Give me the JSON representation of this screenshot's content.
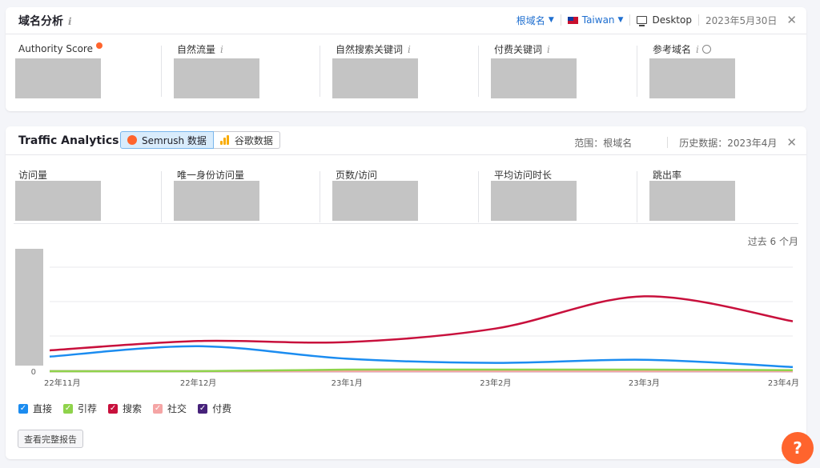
{
  "domain_panel": {
    "title": "域名分析",
    "scope": "根域名",
    "country": "Taiwan",
    "device": "Desktop",
    "date": "2023年5月30日",
    "metrics": [
      {
        "label": "Authority Score"
      },
      {
        "label": "自然流量"
      },
      {
        "label": "自然搜索关键词"
      },
      {
        "label": "付费关键词"
      },
      {
        "label": "参考域名"
      }
    ]
  },
  "traffic_panel": {
    "title": "Traffic Analytics",
    "source_semrush": "Semrush 数据",
    "source_google": "谷歌数据",
    "scope_text": "范围：根域名",
    "history_text": "历史数据：2023年4月",
    "metrics": [
      {
        "label": "访问量"
      },
      {
        "label": "唯一身份访问量"
      },
      {
        "label": "页数/访问"
      },
      {
        "label": "平均访问时长"
      },
      {
        "label": "跳出率"
      }
    ],
    "range_label": "过去 6 个月",
    "report_button": "查看完整报告"
  },
  "icons": {
    "info": "info-icon",
    "close": "close-icon",
    "help": "help-icon"
  },
  "help_label": "?",
  "chart_data": {
    "type": "line",
    "x": [
      "22年11月",
      "22年12月",
      "23年1月",
      "23年2月",
      "23年3月",
      "23年4月"
    ],
    "y_tick_labels": [
      "0"
    ],
    "grid": true,
    "legend_position": "bottom-left",
    "series": [
      {
        "name": "直接",
        "color": "#1b8cf0",
        "values": [
          0.14,
          0.24,
          0.12,
          0.08,
          0.11,
          0.04
        ]
      },
      {
        "name": "引荐",
        "color": "#8fd34b",
        "values": [
          0,
          0,
          0.015,
          0.015,
          0.015,
          0.01
        ]
      },
      {
        "name": "搜索",
        "color": "#c8103c",
        "values": [
          0.2,
          0.29,
          0.28,
          0.41,
          0.72,
          0.48
        ]
      },
      {
        "name": "社交",
        "color": "#f5a5a5",
        "values": [
          0,
          0,
          0,
          0,
          0,
          0
        ]
      },
      {
        "name": "付费",
        "color": "#46227a",
        "values": [
          0,
          0,
          0,
          0,
          0,
          0
        ]
      }
    ]
  }
}
